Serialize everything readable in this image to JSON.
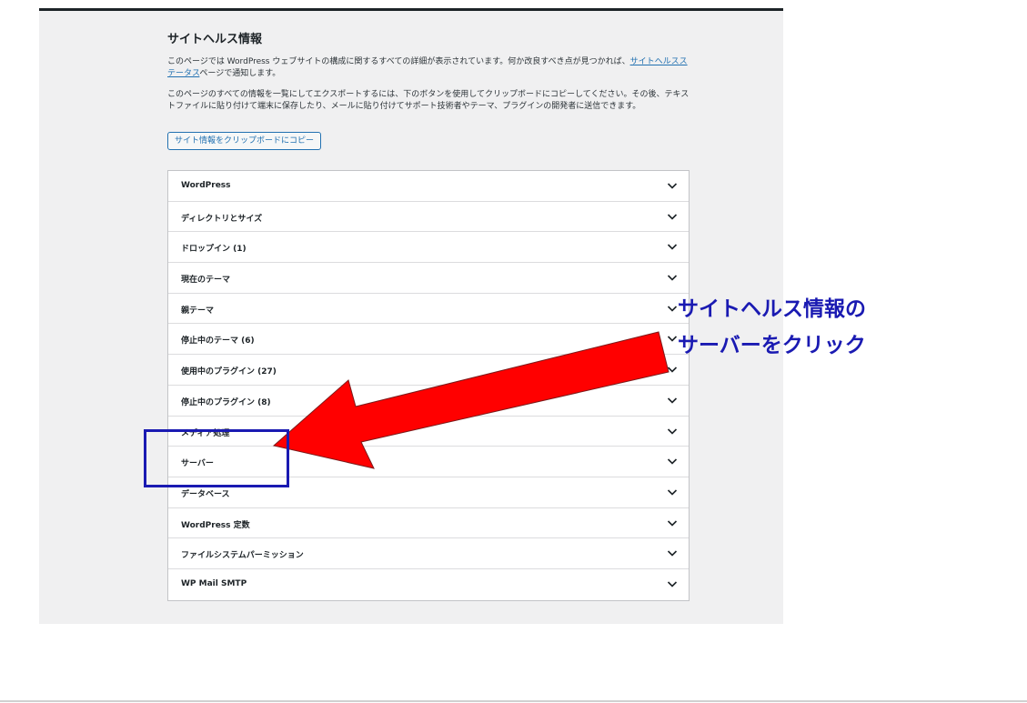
{
  "site_health": {
    "title": "サイトヘルス情報",
    "desc1_before_link": "このページでは WordPress ウェブサイトの構成に関するすべての詳細が表示されています。何か改良すべき点が見つかれば、",
    "desc1_link": "サイトヘルスステータス",
    "desc1_after_link": "ページで通知します。",
    "desc2": "このページのすべての情報を一覧にしてエクスポートするには、下のボタンを使用してクリップボードにコピーしてください。その後、テキストファイルに貼り付けて端末に保存したり、メールに貼り付けてサポート技術者やテーマ、プラグインの開発者に送信できます。",
    "copy_button": "サイト情報をクリップボードにコピー",
    "sections": [
      {
        "label": "WordPress"
      },
      {
        "label": "ディレクトリとサイズ"
      },
      {
        "label": "ドロップイン (1)"
      },
      {
        "label": "現在のテーマ"
      },
      {
        "label": "親テーマ"
      },
      {
        "label": "停止中のテーマ (6)"
      },
      {
        "label": "使用中のプラグイン (27)"
      },
      {
        "label": "停止中のプラグイン (8)"
      },
      {
        "label": "メディア処理"
      },
      {
        "label": "サーバー"
      },
      {
        "label": "データベース"
      },
      {
        "label": "WordPress 定数"
      },
      {
        "label": "ファイルシステムパーミッション"
      },
      {
        "label": "WP Mail SMTP"
      }
    ]
  },
  "annotation": {
    "line1": "サイトヘルス情報の",
    "line2": "サーバーをクリック",
    "arrow_color": "#ff0000",
    "highlight_color": "#1a1ab2"
  }
}
